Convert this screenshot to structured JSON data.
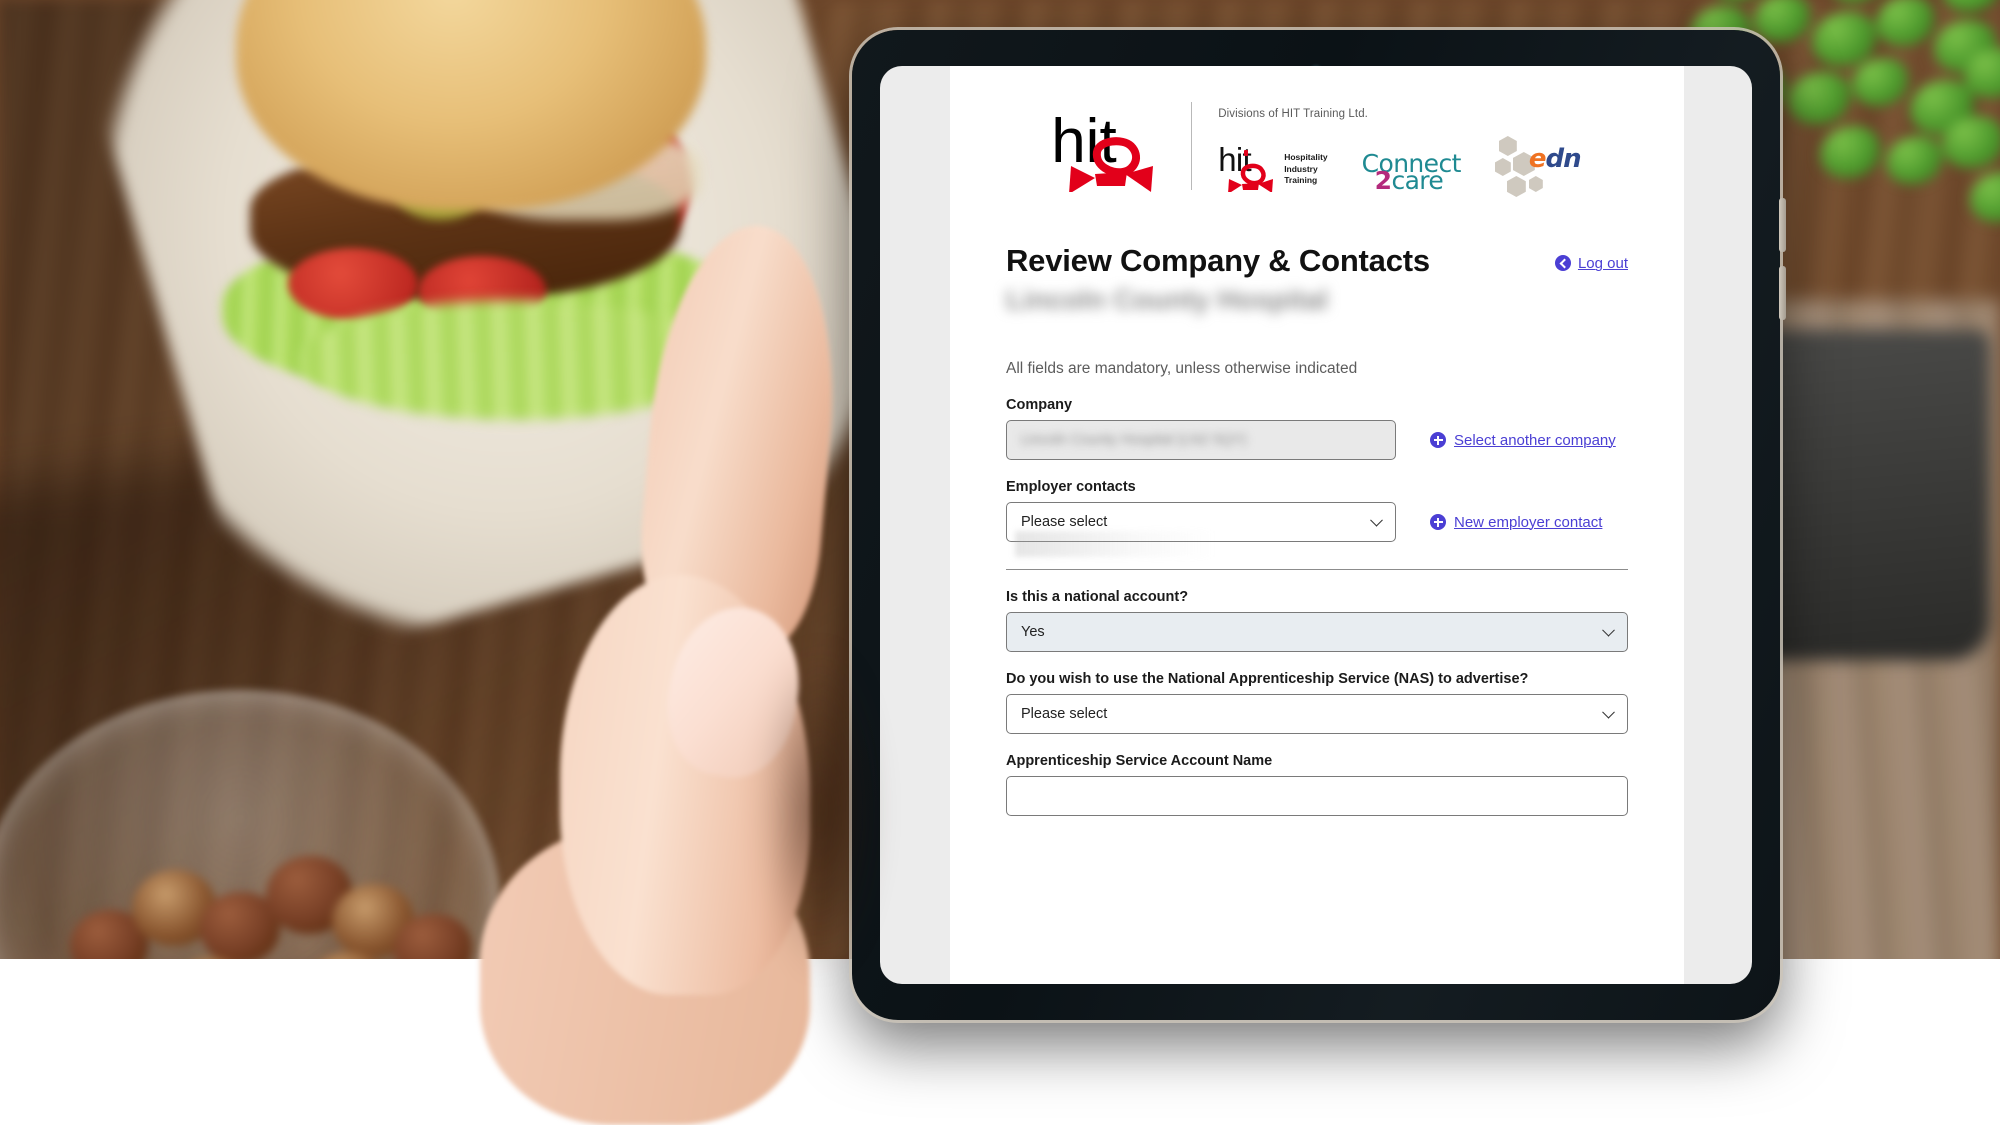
{
  "device": {
    "type": "tablet",
    "camera": "front-camera"
  },
  "branding": {
    "primary_logo_text": "hit",
    "divisions_text": "Divisions of HIT Training Ltd.",
    "brands": [
      {
        "name": "hit",
        "sub_lines": [
          "Hospitality",
          "Industry",
          "Training"
        ]
      },
      {
        "name": "Connect2care",
        "part_1": "Connect",
        "part_2": "2",
        "part_3": "care"
      },
      {
        "name": "edn",
        "part_1": "e",
        "part_2": "dn"
      }
    ],
    "colors": {
      "hit_red": "#e2001a",
      "connect_teal": "#1f8a92",
      "connect_magenta": "#b42a7c",
      "edn_orange": "#ef7222",
      "edn_blue": "#2f4a8c",
      "link_purple": "#4b3fd4"
    }
  },
  "header": {
    "title": "Review Company & Contacts",
    "subtitle_redacted": "Lincoln County Hospital",
    "logout_label": "Log out"
  },
  "form": {
    "mandatory_note": "All fields are mandatory, unless otherwise indicated",
    "company": {
      "label": "Company",
      "value_redacted": "Lincoln County Hospital (LN2 5QY)",
      "disabled": "true",
      "action_label": "Select another company"
    },
    "employer_contacts": {
      "label": "Employer contacts",
      "value": "Please select",
      "action_label": "New employer contact"
    },
    "national_account": {
      "label": "Is this a national account?",
      "value": "Yes"
    },
    "nas_advertise": {
      "label": "Do you wish to use the National Apprenticeship Service (NAS) to advertise?",
      "value": "Please select"
    },
    "service_account_name": {
      "label": "Apprenticeship Service Account Name",
      "value": "",
      "placeholder": ""
    }
  }
}
